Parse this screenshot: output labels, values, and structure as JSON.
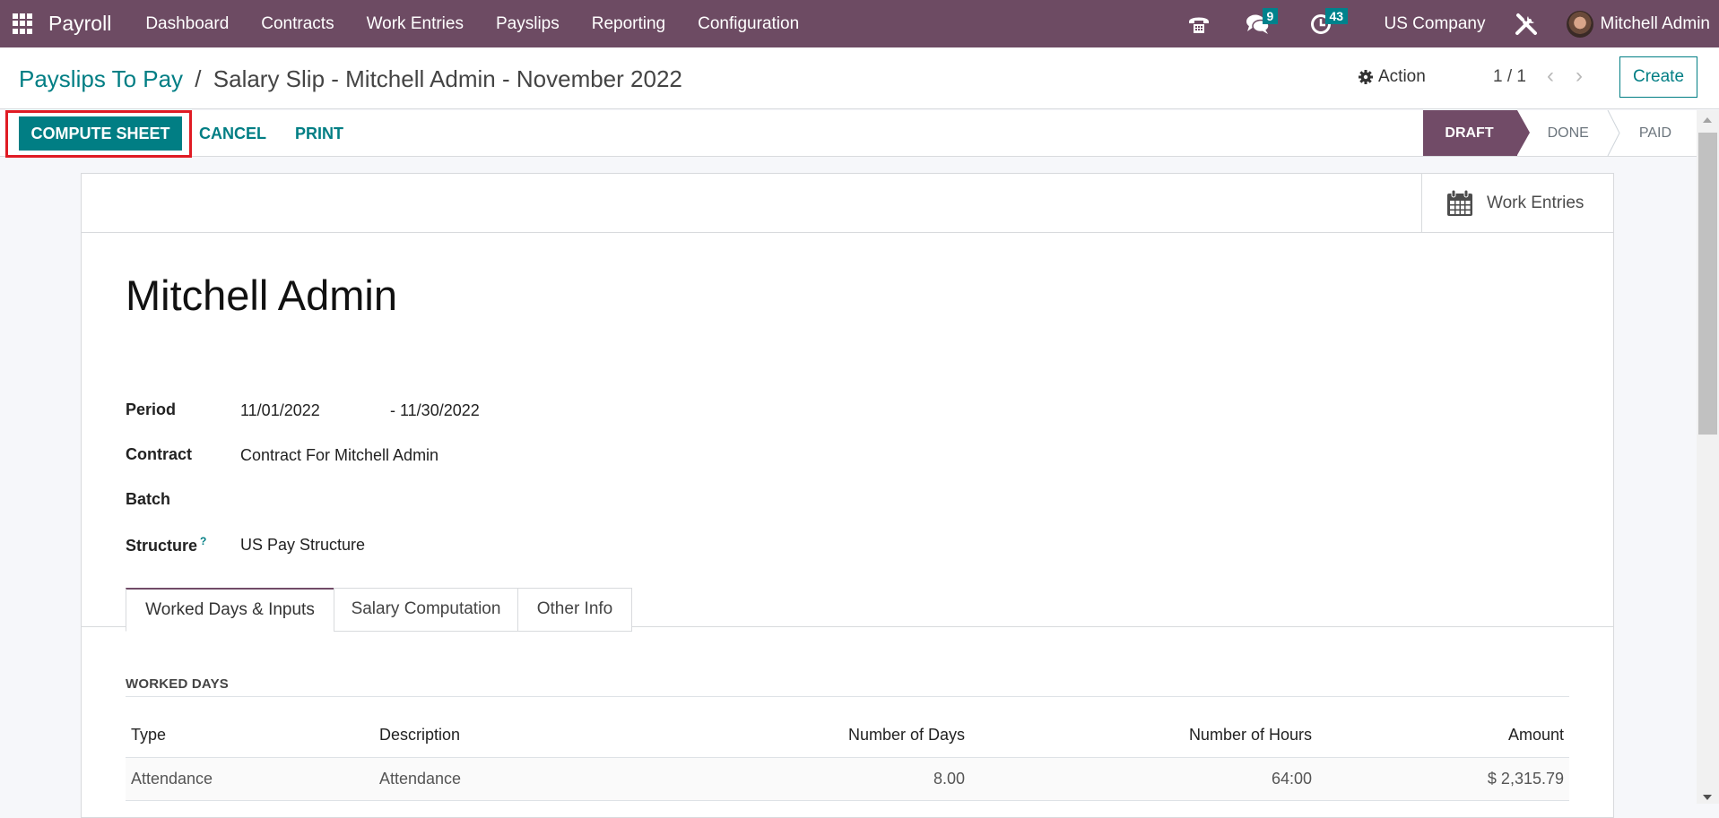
{
  "navbar": {
    "app_name": "Payroll",
    "menu": [
      "Dashboard",
      "Contracts",
      "Work Entries",
      "Payslips",
      "Reporting",
      "Configuration"
    ],
    "messages_count": "9",
    "activities_count": "43",
    "company": "US Company",
    "user": "Mitchell Admin",
    "colors": {
      "bar": "#6d4b63",
      "badge": "#00828c"
    }
  },
  "control_panel": {
    "breadcrumb_parent": "Payslips To Pay",
    "breadcrumb_separator": "/",
    "breadcrumb_current": "Salary Slip - Mitchell Admin - November 2022",
    "action_label": "Action",
    "pager": "1 / 1",
    "create_label": "Create"
  },
  "statusbar": {
    "buttons": {
      "compute": "COMPUTE SHEET",
      "cancel": "CANCEL",
      "print": "PRINT"
    },
    "stages": [
      {
        "label": "DRAFT",
        "active": true
      },
      {
        "label": "DONE",
        "active": false
      },
      {
        "label": "PAID",
        "active": false
      }
    ],
    "highlight_color": "#e01b24",
    "primary_color": "#017e84"
  },
  "sheet": {
    "smart_button": "Work Entries",
    "employee_name": "Mitchell Admin",
    "fields": {
      "period_label": "Period",
      "period_from": "11/01/2022",
      "period_to": "- 11/30/2022",
      "contract_label": "Contract",
      "contract_value": "Contract For Mitchell Admin",
      "batch_label": "Batch",
      "batch_value": "",
      "structure_label": "Structure",
      "structure_help": "?",
      "structure_value": "US Pay Structure"
    },
    "tabs": [
      {
        "label": "Worked Days & Inputs",
        "active": true
      },
      {
        "label": "Salary Computation",
        "active": false
      },
      {
        "label": "Other Info",
        "active": false
      }
    ],
    "worked_days": {
      "title": "WORKED DAYS",
      "columns": [
        "Type",
        "Description",
        "Number of Days",
        "Number of Hours",
        "Amount"
      ],
      "rows": [
        [
          "Attendance",
          "Attendance",
          "8.00",
          "64:00",
          "$ 2,315.79"
        ]
      ]
    }
  }
}
